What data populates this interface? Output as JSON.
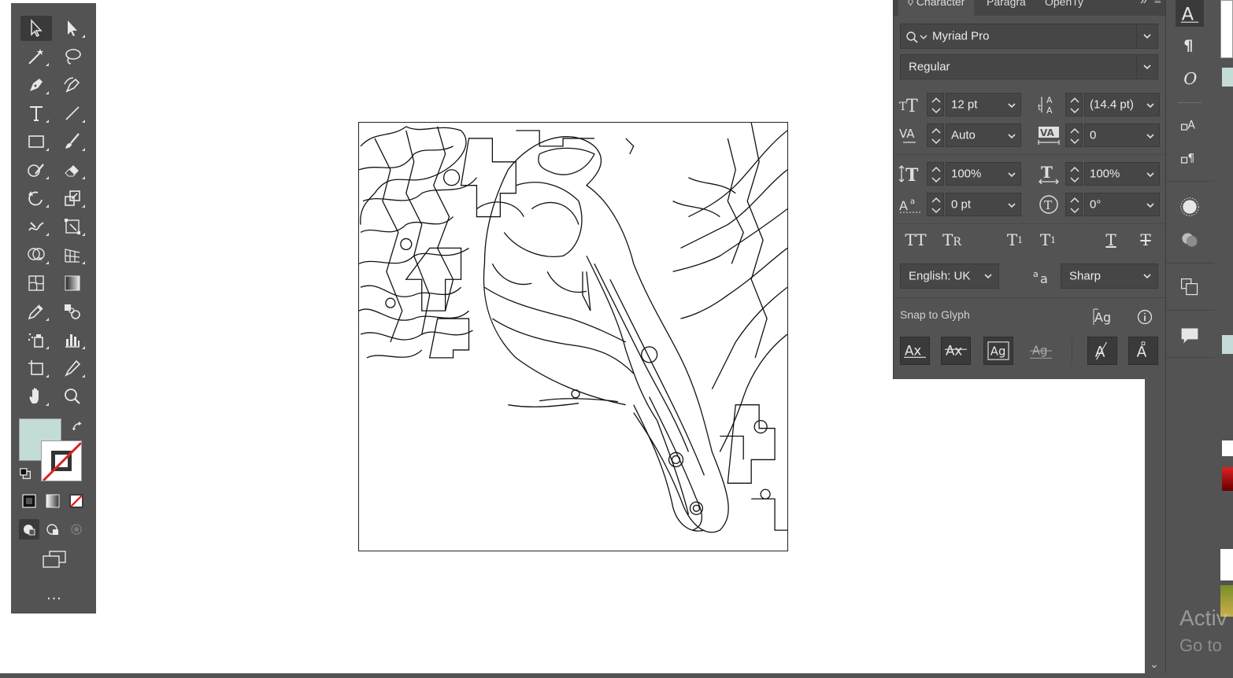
{
  "character_panel": {
    "tabs": [
      {
        "label": "Character"
      },
      {
        "label": "Paragra"
      },
      {
        "label": "OpenTy"
      }
    ],
    "font_family": "Myriad Pro",
    "font_style": "Regular",
    "font_size": "12 pt",
    "leading": "(14.4 pt)",
    "kerning": "Auto",
    "tracking": "0",
    "vertical_scale": "100%",
    "horizontal_scale": "100%",
    "baseline_shift": "0 pt",
    "rotation": "0°",
    "language": "English: UK",
    "anti_alias": "Sharp",
    "snap_to_glyph_label": "Snap to Glyph",
    "glyph_buttons": [
      "TT",
      "Tr",
      "T",
      "T",
      "T",
      "T"
    ]
  },
  "toolbar": {
    "fill_color": "#c4dcd8",
    "stroke_color": "none",
    "more_label": "..."
  },
  "watermark": {
    "line1": "Activ",
    "line2": "Go to"
  },
  "colors": {
    "panel_bg": "#535353",
    "field_bg": "#464646",
    "text": "#ececec"
  }
}
